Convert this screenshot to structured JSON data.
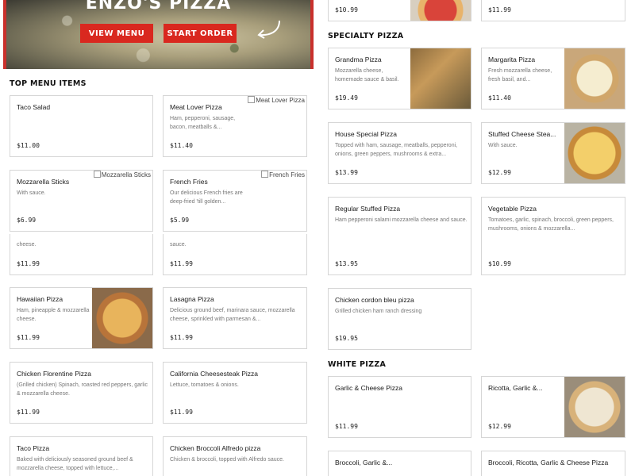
{
  "hero": {
    "title": "ENZO'S PIZZA",
    "view_menu": "VIEW MENU",
    "start_order": "START ORDER"
  },
  "sections": {
    "top_menu": "TOP MENU ITEMS",
    "specialty": "SPECIALTY PIZZA",
    "white": "WHITE PIZZA"
  },
  "top_partial": {
    "left_price": "$10.99",
    "right_price": "$11.99"
  },
  "left_cards": [
    {
      "name": "Taco Salad",
      "desc": "",
      "price": "$11.00"
    },
    {
      "name": "Meat Lover Pizza",
      "desc": "Ham, pepperoni, sausage, bacon, meatballs &...",
      "price": "$11.40",
      "img_alt": "Meat Lover Pizza"
    },
    {
      "name": "Mozzarella Sticks",
      "desc": "With sauce.",
      "price": "$6.99",
      "img_alt": "Mozzarella Sticks"
    },
    {
      "name": "French Fries",
      "desc": "Our delicious French fries are deep-fried 'till golden...",
      "price": "$5.99",
      "img_alt": "French Fries"
    },
    {
      "name": "",
      "desc": "cheese.",
      "price": "$11.99"
    },
    {
      "name": "",
      "desc": "sauce.",
      "price": "$11.99"
    },
    {
      "name": "Hawaiian Pizza",
      "desc": "Ham, pineapple & mozzarella cheese.",
      "price": "$11.99"
    },
    {
      "name": "Lasagna Pizza",
      "desc": "Delicious ground beef, marinara sauce, mozzarella cheese, sprinkled with parmesan &...",
      "price": "$11.99"
    },
    {
      "name": "Chicken Florentine Pizza",
      "desc": "(Grilled chicken) Spinach, roasted red peppers, garlic & mozzarella cheese.",
      "price": "$11.99"
    },
    {
      "name": "California Cheesesteak Pizza",
      "desc": "Lettuce, tomatoes & onions.",
      "price": "$11.99"
    },
    {
      "name": "Taco Pizza",
      "desc": "Baked with deliciously seasoned ground beef & mozzarella cheese, topped with lettuce,...",
      "price": ""
    },
    {
      "name": "Chicken Broccoli Alfredo pizza",
      "desc": "Chicken & broccoli, topped with Alfredo sauce.",
      "price": ""
    }
  ],
  "specialty_cards": [
    {
      "name": "Grandma Pizza",
      "desc": "Mozzarella cheese, homemade sauce & basil.",
      "price": "$19.49"
    },
    {
      "name": "Margarita Pizza",
      "desc": "Fresh mozzarella cheese, fresh basil, and...",
      "price": "$11.40"
    },
    {
      "name": "House Special Pizza",
      "desc": "Topped with ham, sausage, meatballs, pepperoni, onions, green peppers, mushrooms & extra...",
      "price": "$13.99"
    },
    {
      "name": "Stuffed Cheese Stea...",
      "desc": "With sauce.",
      "price": "$12.99"
    },
    {
      "name": "Regular Stuffed Pizza",
      "desc": "Ham pepperoni salami mozzarella cheese and sauce.",
      "price": "$13.95"
    },
    {
      "name": "Vegetable Pizza",
      "desc": "Tomatoes, garlic, spinach, broccoli, green peppers, mushrooms, onions & mozzarella...",
      "price": "$10.99"
    },
    {
      "name": "Chicken cordon bleu pizza",
      "desc": "Grilled chicken ham ranch dressing",
      "price": "$19.95"
    }
  ],
  "white_cards": [
    {
      "name": "Garlic & Cheese Pizza",
      "desc": "",
      "price": "$11.99"
    },
    {
      "name": "Ricotta, Garlic &...",
      "desc": "",
      "price": "$12.99"
    },
    {
      "name": "Broccoli, Garlic &...",
      "desc": "",
      "price": ""
    },
    {
      "name": "Broccoli, Ricotta, Garlic & Cheese Pizza",
      "desc": "",
      "price": ""
    }
  ]
}
